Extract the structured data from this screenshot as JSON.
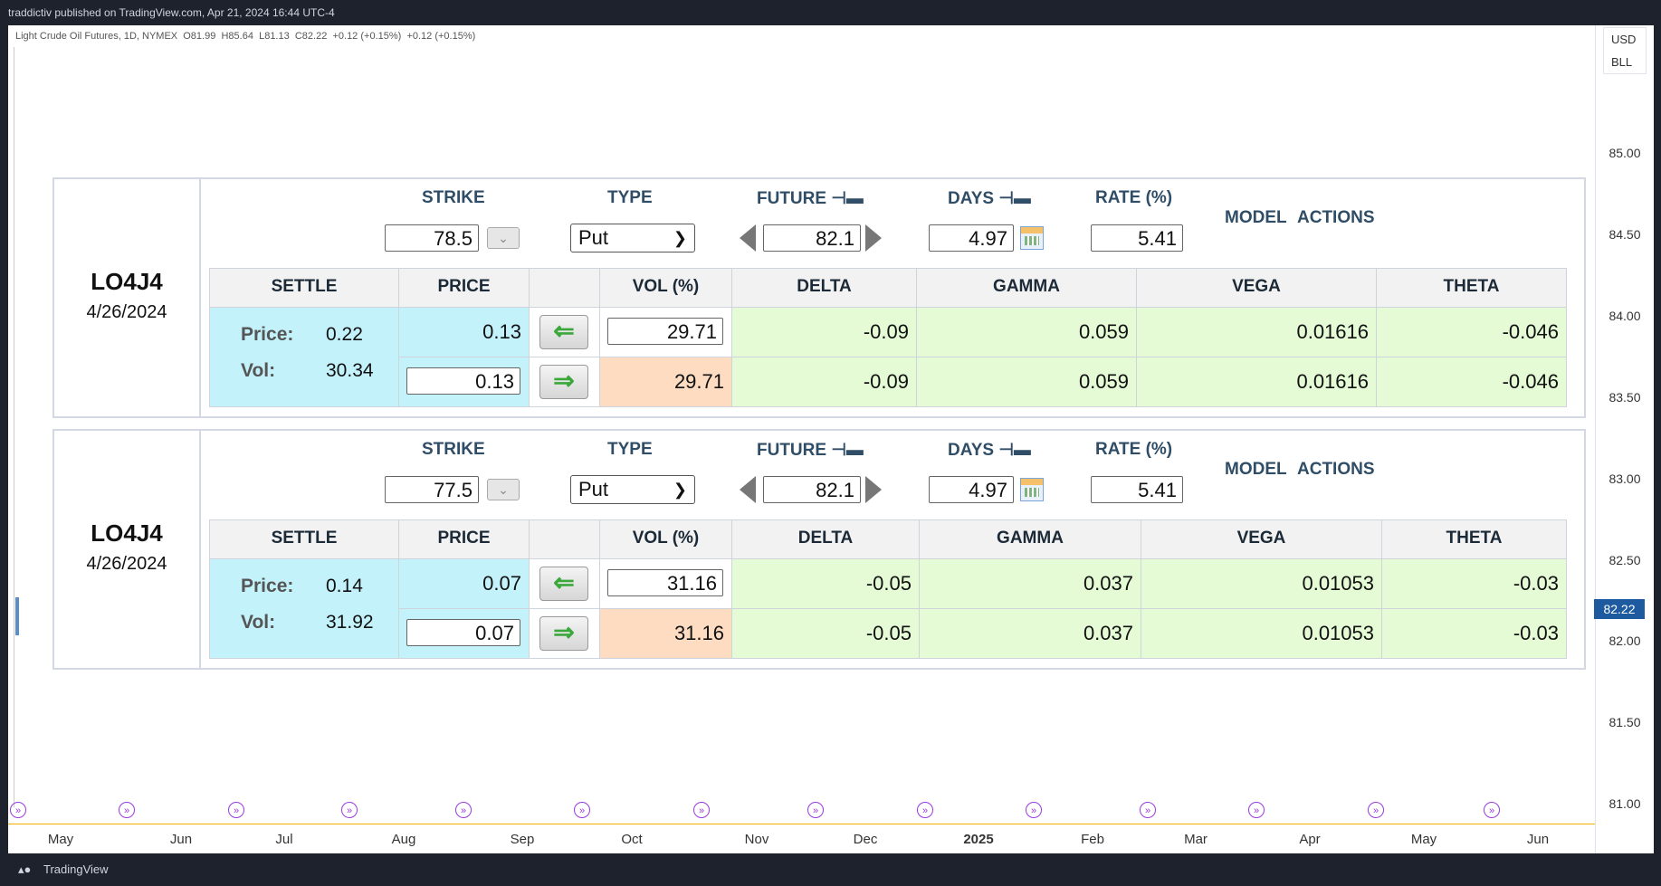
{
  "header": {
    "published": "traddictiv published on TradingView.com, Apr 21, 2024 16:44 UTC-4"
  },
  "legend": {
    "symbol": "Light Crude Oil Futures, 1D, NYMEX",
    "open": "O81.99",
    "high": "H85.64",
    "low": "L81.13",
    "close": "C82.22",
    "change1": "+0.12 (+0.15%)",
    "change2": "+0.12 (+0.15%)"
  },
  "price_axis": {
    "currency": "USD",
    "unit": "BLL",
    "ticks": [
      "85.00",
      "84.50",
      "84.00",
      "83.50",
      "83.00",
      "82.50",
      "82.00",
      "81.50",
      "81.00"
    ],
    "last_price": "82.22"
  },
  "time_axis": {
    "months": [
      "May",
      "Jun",
      "Jul",
      "Aug",
      "Sep",
      "Oct",
      "Nov",
      "Dec",
      "2025",
      "Feb",
      "Mar",
      "Apr",
      "May",
      "Jun"
    ]
  },
  "panel_headers": {
    "strike": "STRIKE",
    "type": "TYPE",
    "future": "FUTURE",
    "days": "DAYS",
    "rate": "RATE (%)",
    "model": "MODEL",
    "actions": "ACTIONS",
    "settle": "SETTLE",
    "price": "PRICE",
    "vol": "VOL (%)",
    "delta": "DELTA",
    "gamma": "GAMMA",
    "vega": "VEGA",
    "theta": "THETA",
    "price_label": "Price:",
    "vol_label": "Vol:",
    "pin_icon": "⊣▬"
  },
  "options": [
    {
      "symbol": "LO4J4",
      "expiry": "4/26/2024",
      "strike": "78.5",
      "type": "Put",
      "future": "82.1",
      "days": "4.97",
      "rate": "5.41",
      "settle_price": "0.22",
      "settle_vol": "30.34",
      "price_calc": "0.13",
      "price_input": "0.13",
      "vol_input": "29.71",
      "vol_calc": "29.71",
      "row1": {
        "delta": "-0.09",
        "gamma": "0.059",
        "vega": "0.01616",
        "theta": "-0.046"
      },
      "row2": {
        "delta": "-0.09",
        "gamma": "0.059",
        "vega": "0.01616",
        "theta": "-0.046"
      }
    },
    {
      "symbol": "LO4J4",
      "expiry": "4/26/2024",
      "strike": "77.5",
      "type": "Put",
      "future": "82.1",
      "days": "4.97",
      "rate": "5.41",
      "settle_price": "0.14",
      "settle_vol": "31.92",
      "price_calc": "0.07",
      "price_input": "0.07",
      "vol_input": "31.16",
      "vol_calc": "31.16",
      "row1": {
        "delta": "-0.05",
        "gamma": "0.037",
        "vega": "0.01053",
        "theta": "-0.03"
      },
      "row2": {
        "delta": "-0.05",
        "gamma": "0.037",
        "vega": "0.01053",
        "theta": "-0.03"
      }
    }
  ],
  "footer": {
    "brand": "TradingView"
  },
  "colors": {
    "background": "#1e222d",
    "last_price_tag": "#1e5aa0",
    "event_marker": "#9b3be0",
    "settle_cell": "#c4f2fb",
    "greek_cell": "#e4fbd6",
    "vol_cell": "#fddcc2"
  }
}
